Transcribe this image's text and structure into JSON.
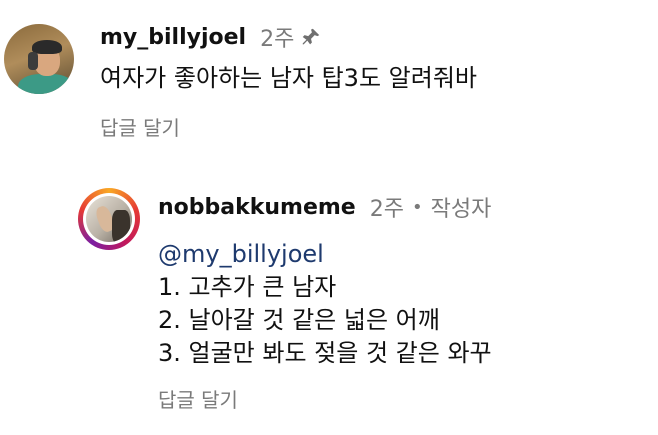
{
  "comment_1": {
    "username": "my_billyjoel",
    "time": "2주",
    "text": "여자가 좋아하는 남자 탑3도 알려줘바",
    "reply_label": "답글 달기",
    "pin_icon": "pin-icon"
  },
  "comment_2": {
    "username": "nobbakkumeme",
    "time": "2주",
    "separator": "•",
    "author_badge": "작성자",
    "mention": "@my_billyjoel",
    "lines": [
      "1. 고추가 큰 남자",
      "2. 날아갈 것 같은 넓은 어깨",
      "3. 얼굴만 봐도 젖을 것 같은 와꾸"
    ],
    "reply_label": "답글 달기"
  },
  "colors": {
    "text": "#111111",
    "meta": "#7a7a7a",
    "mention": "#1e3a6e",
    "story_ring": [
      "#f9a825",
      "#e53935",
      "#c2185b",
      "#7b1fa2"
    ]
  }
}
